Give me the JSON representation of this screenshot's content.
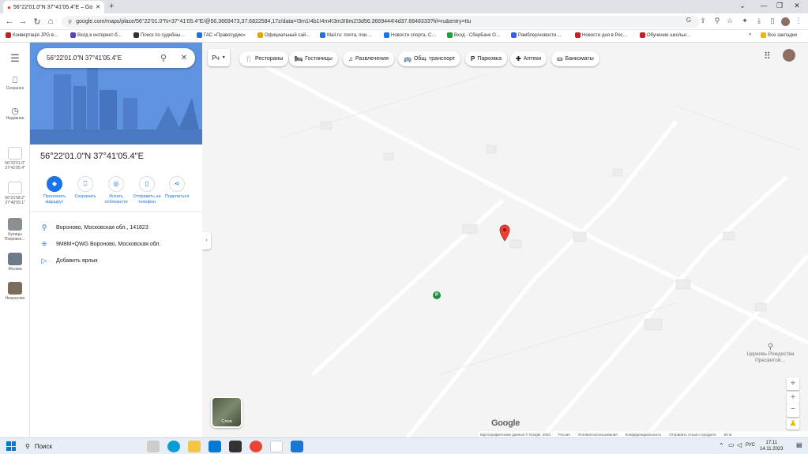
{
  "browser": {
    "tab_title": "56°22'01.0\"N 37°41'05.4\"E – Go",
    "url": "google.com/maps/place/56°22'01.0\"N+37°41'05.4\"E/@56.3669473,37.6822584,17z/data=!3m1!4b1!4m4!3m3!8m2!3d56.3669444!4d37.6848333?hl=ru&entry=ttu",
    "bookmarks": [
      {
        "label": "Конвертація JPG в…",
        "color": "#c5221f"
      },
      {
        "label": "Вход в интернет-б…",
        "color": "#5f3dc4"
      },
      {
        "label": "Поиск по судебны…",
        "color": "#333333"
      },
      {
        "label": "ГАС «Правосудие»",
        "color": "#1a73e8"
      },
      {
        "label": "Официальный сай…",
        "color": "#e0a800"
      },
      {
        "label": "Mail.ru: почта, пои…",
        "color": "#1a73e8"
      },
      {
        "label": "Новости спорта, С…",
        "color": "#1a73e8"
      },
      {
        "label": "Вход - СберБанк О…",
        "color": "#21a038"
      },
      {
        "label": "Рамблер/новости…",
        "color": "#315efb"
      },
      {
        "label": "Новости дня в Рос…",
        "color": "#c5221f"
      },
      {
        "label": "Обучение школьн…",
        "color": "#c5221f"
      }
    ],
    "all_bookmarks": "Все закладки"
  },
  "rail": {
    "saved": "Сохранен",
    "recent": "Недавние",
    "history": [
      {
        "label": "56°22'01.0\" 37°41'05.4\""
      },
      {
        "label": "56°21'58.2\" 37°40'59.1\""
      },
      {
        "label": "Кулицы Покровск…"
      },
      {
        "label": "Москва"
      },
      {
        "label": "Некрасово"
      }
    ]
  },
  "panel": {
    "search_value": "56°22'01.0\"N 37°41'05.4\"E",
    "title": "56°22'01.0\"N 37°41'05.4\"E",
    "actions": [
      {
        "label": "Проложить маршрут"
      },
      {
        "label": "Сохранить"
      },
      {
        "label": "Искать поблизости"
      },
      {
        "label": "Отправить на телефон"
      },
      {
        "label": "Поделиться"
      }
    ],
    "address": "Вороново, Московская обл., 141823",
    "plus_code": "9M8M+QWG Вороново, Московская обл.",
    "add_label": "Добавить ярлык"
  },
  "map": {
    "type_label": "Рч",
    "chips": [
      {
        "icon": "🍴",
        "label": "Рестораны"
      },
      {
        "icon": "🛏",
        "label": "Гостиницы"
      },
      {
        "icon": "♫",
        "label": "Развлечения"
      },
      {
        "icon": "🚌",
        "label": "Общ. транспорт"
      },
      {
        "icon": "P",
        "label": "Парковка"
      },
      {
        "icon": "✚",
        "label": "Аптеки"
      },
      {
        "icon": "▭",
        "label": "Банкоматы"
      }
    ],
    "poi_label": "Церковь Рождества Пресвятой…",
    "layers_label": "Слои",
    "google": "Google",
    "footer": [
      "Картографические данные © Google, 2023",
      "Россия",
      "Условия использования",
      "Конфиденциальность",
      "Отправить отзыв о продукте",
      "50 м"
    ]
  },
  "taskbar": {
    "search": "Поиск",
    "lang": "РУС",
    "time": "17:11",
    "date": "14.11.2023"
  }
}
